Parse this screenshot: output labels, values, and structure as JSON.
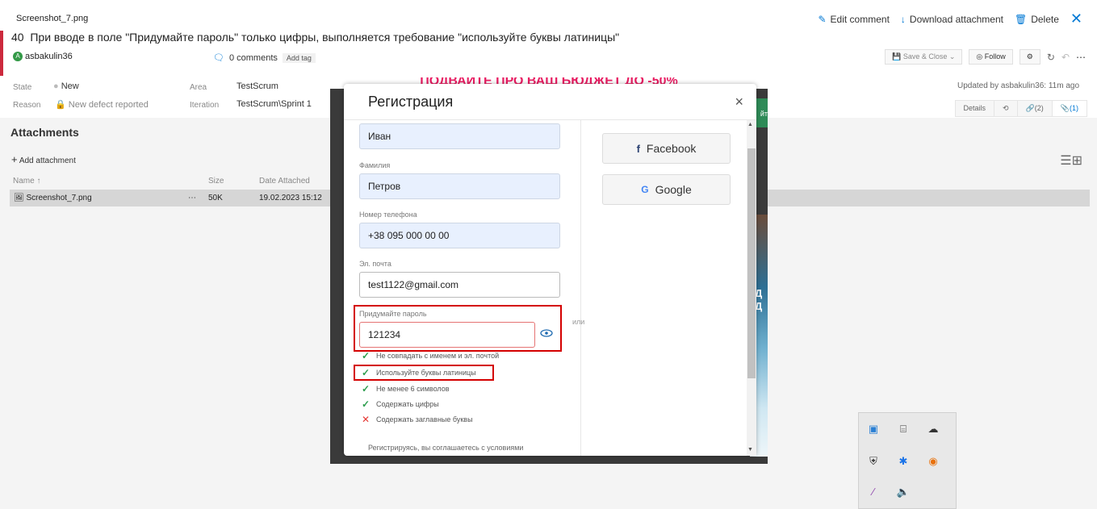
{
  "viewer": {
    "file_name": "Screenshot_7.png",
    "edit_comment": "Edit comment",
    "download": "Download attachment",
    "delete": "Delete"
  },
  "work_item": {
    "id": "40",
    "title": "При вводе в поле \"Придумайте пароль\" только цифры, выполняется требование \"используйте буквы латиницы\"",
    "assignee": "asbakulin36",
    "avatar_letter": "A",
    "comments": "0 comments",
    "add_tag": "Add tag",
    "save_close": "Save & Close",
    "follow": "Follow",
    "updated": "Updated by asbakulin36: 11m ago",
    "fields": {
      "state_label": "State",
      "state_value": "New",
      "reason_label": "Reason",
      "reason_value": "New defect reported",
      "area_label": "Area",
      "area_value": "TestScrum",
      "iteration_label": "Iteration",
      "iteration_value": "TestScrum\\Sprint 1"
    },
    "tabs": {
      "details": "Details",
      "links": "(2)",
      "attachments": "(1)"
    }
  },
  "attachments": {
    "title": "Attachments",
    "add": "Add attachment",
    "columns": {
      "name": "Name ↑",
      "size": "Size",
      "date": "Date Attached"
    },
    "rows": [
      {
        "name": "Screenshot_7.png",
        "size": "50K",
        "date": "19.02.2023 15:12"
      }
    ]
  },
  "screenshot": {
    "banner": "ПОДВАЙТЕ ПРО ВАШ БЮДЖЕТ ДО -50%",
    "side_green_text": "йт",
    "side_letters": "Д\nД",
    "modal": {
      "title": "Регистрация",
      "close": "×",
      "first_name_value": "Иван",
      "last_name_label": "Фамилия",
      "last_name_value": "Петров",
      "phone_label": "Номер телефона",
      "phone_value": "+38 095 000 00 00",
      "email_label": "Эл. почта",
      "email_value": "test1122@gmail.com",
      "password_label": "Придумайте пароль",
      "password_value": "121234",
      "or": "или",
      "facebook": "Facebook",
      "google": "Google",
      "requirements": [
        {
          "text": "Не совпадать с именем и эл. почтой",
          "ok": true
        },
        {
          "text": "Используйте буквы латиницы",
          "ok": true
        },
        {
          "text": "Не менее 6 символов",
          "ok": true
        },
        {
          "text": "Содержать цифры",
          "ok": true
        },
        {
          "text": "Содержать заглавные буквы",
          "ok": false
        }
      ],
      "terms": "Регистрируясь, вы соглашаетесь с условиями"
    }
  },
  "colors": {
    "accent": "#0078d4",
    "bug_red": "#cc293d",
    "highlight_red": "#d40000",
    "check_green": "#2e9e4f"
  }
}
